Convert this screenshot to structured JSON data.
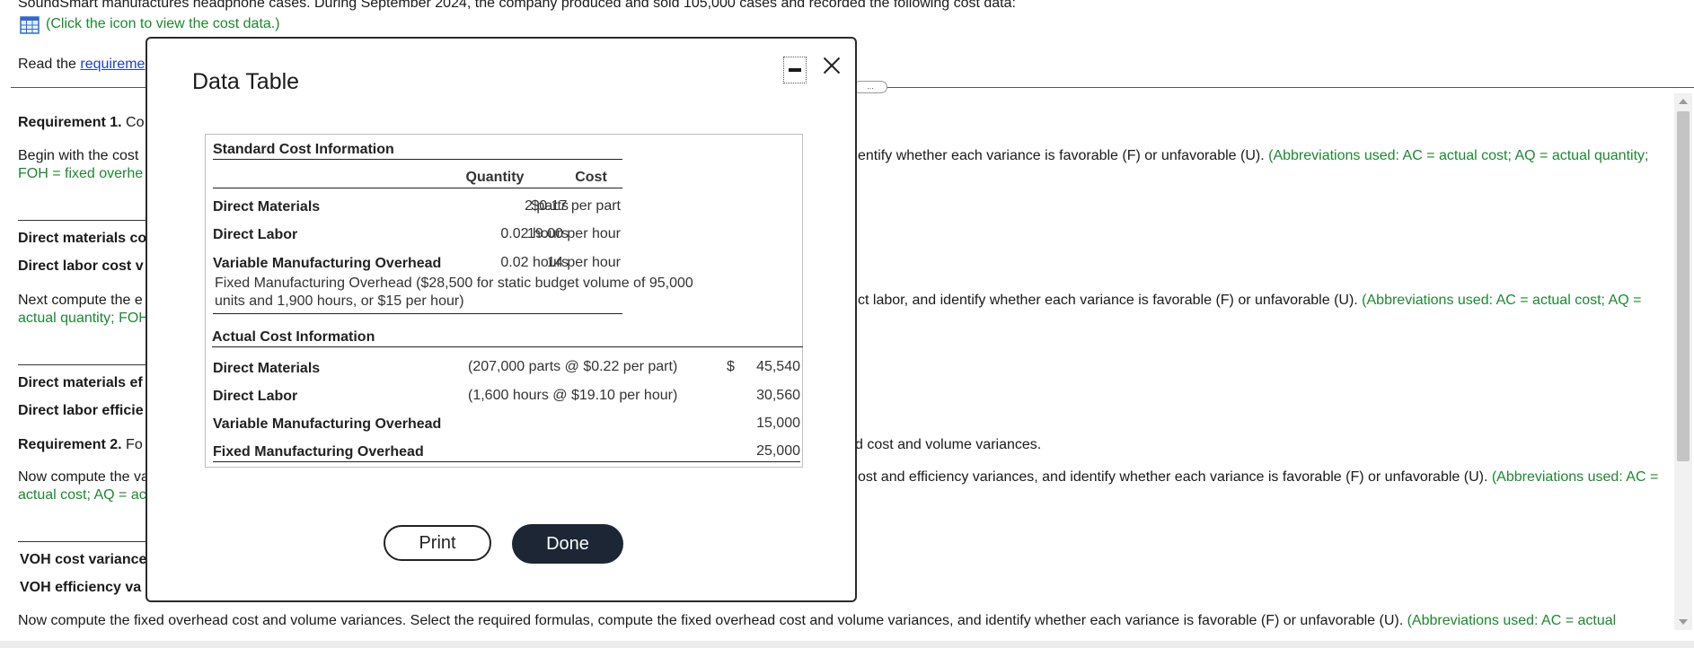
{
  "background": {
    "intro_text": "SoundSmart manufactures headphone cases. During September 2024, the company produced and sold 105,000 cases and recorded the following cost data:",
    "click_icon_text": "(Click the icon to view the cost data.)",
    "read_prefix": "Read the ",
    "read_link": "requireme",
    "req1_label": "Requirement 1.",
    "req1_fragment": "Co",
    "begin_left": "Begin with the cost",
    "begin_right_black": "entify whether each variance is favorable (F) or unfavorable (U).",
    "begin_right_green": "(Abbreviations used: AC = actual cost; AQ = actual quantity;",
    "begin_line2": "FOH = fixed overhe",
    "dm_cost_label": "Direct materials co",
    "dl_cost_label": "Direct labor cost v",
    "next_left": "Next compute the e",
    "next_right_black": "ct labor, and identify whether each variance is favorable (F) or unfavorable (U).",
    "next_right_green": "(Abbreviations used: AC = actual cost; AQ =",
    "next_line2": "actual quantity; FOH",
    "dm_eff_label": "Direct materials ef",
    "dl_eff_label": "Direct labor efficie",
    "req2_label": "Requirement 2.",
    "req2_fragment": "Fo",
    "req2_right": "d cost and volume variances.",
    "now_left": "Now compute the va",
    "now_right_black": "ost and efficiency variances, and identify whether each variance is favorable (F) or unfavorable (U).",
    "now_right_green": "(Abbreviations used: AC =",
    "now_line2": "actual cost; AQ = ac",
    "voh_cost_label": "VOH cost variance",
    "voh_eff_label": "VOH efficiency va",
    "bottom_black": "Now compute the fixed overhead cost and volume variances. Select the required formulas, compute the fixed overhead cost and volume variances, and identify whether each variance is favorable (F) or unfavorable (U).",
    "bottom_green": "(Abbreviations used: AC = actual",
    "divider_handle": "..."
  },
  "modal": {
    "title": "Data Table",
    "standard_header": "Standard Cost Information",
    "col_quantity": "Quantity",
    "col_cost": "Cost",
    "standard_rows": [
      {
        "label": "Direct Materials",
        "quantity": "2 parts",
        "cost": "$0.17 per part"
      },
      {
        "label": "Direct Labor",
        "quantity": "0.02 hours",
        "cost": "19.00 per hour"
      },
      {
        "label": "Variable Manufacturing Overhead",
        "quantity": "0.02 hours",
        "cost": "14 per hour"
      }
    ],
    "fixed_note_line1": "Fixed Manufacturing Overhead ($28,500 for static budget volume of 95,000",
    "fixed_note_line2": "units and 1,900 hours, or $15 per hour)",
    "actual_header": "Actual Cost Information",
    "dollar_sign": "$",
    "actual_rows": [
      {
        "label": "Direct Materials",
        "detail": "(207,000 parts @ $0.22 per part)",
        "amount": "45,540"
      },
      {
        "label": "Direct Labor",
        "detail": "(1,600 hours @ $19.10 per hour)",
        "amount": "30,560"
      },
      {
        "label": "Variable Manufacturing Overhead",
        "detail": "",
        "amount": "15,000"
      },
      {
        "label": "Fixed Manufacturing Overhead",
        "detail": "",
        "amount": "25,000"
      }
    ],
    "print_label": "Print",
    "done_label": "Done"
  },
  "colors": {
    "green_text": "#1a8a2e",
    "link": "#1a3fd6",
    "done_button": "#1c2634"
  },
  "icons": {
    "cost_data": "table-grid-icon",
    "minimize": "minimize-icon",
    "close": "close-icon"
  }
}
